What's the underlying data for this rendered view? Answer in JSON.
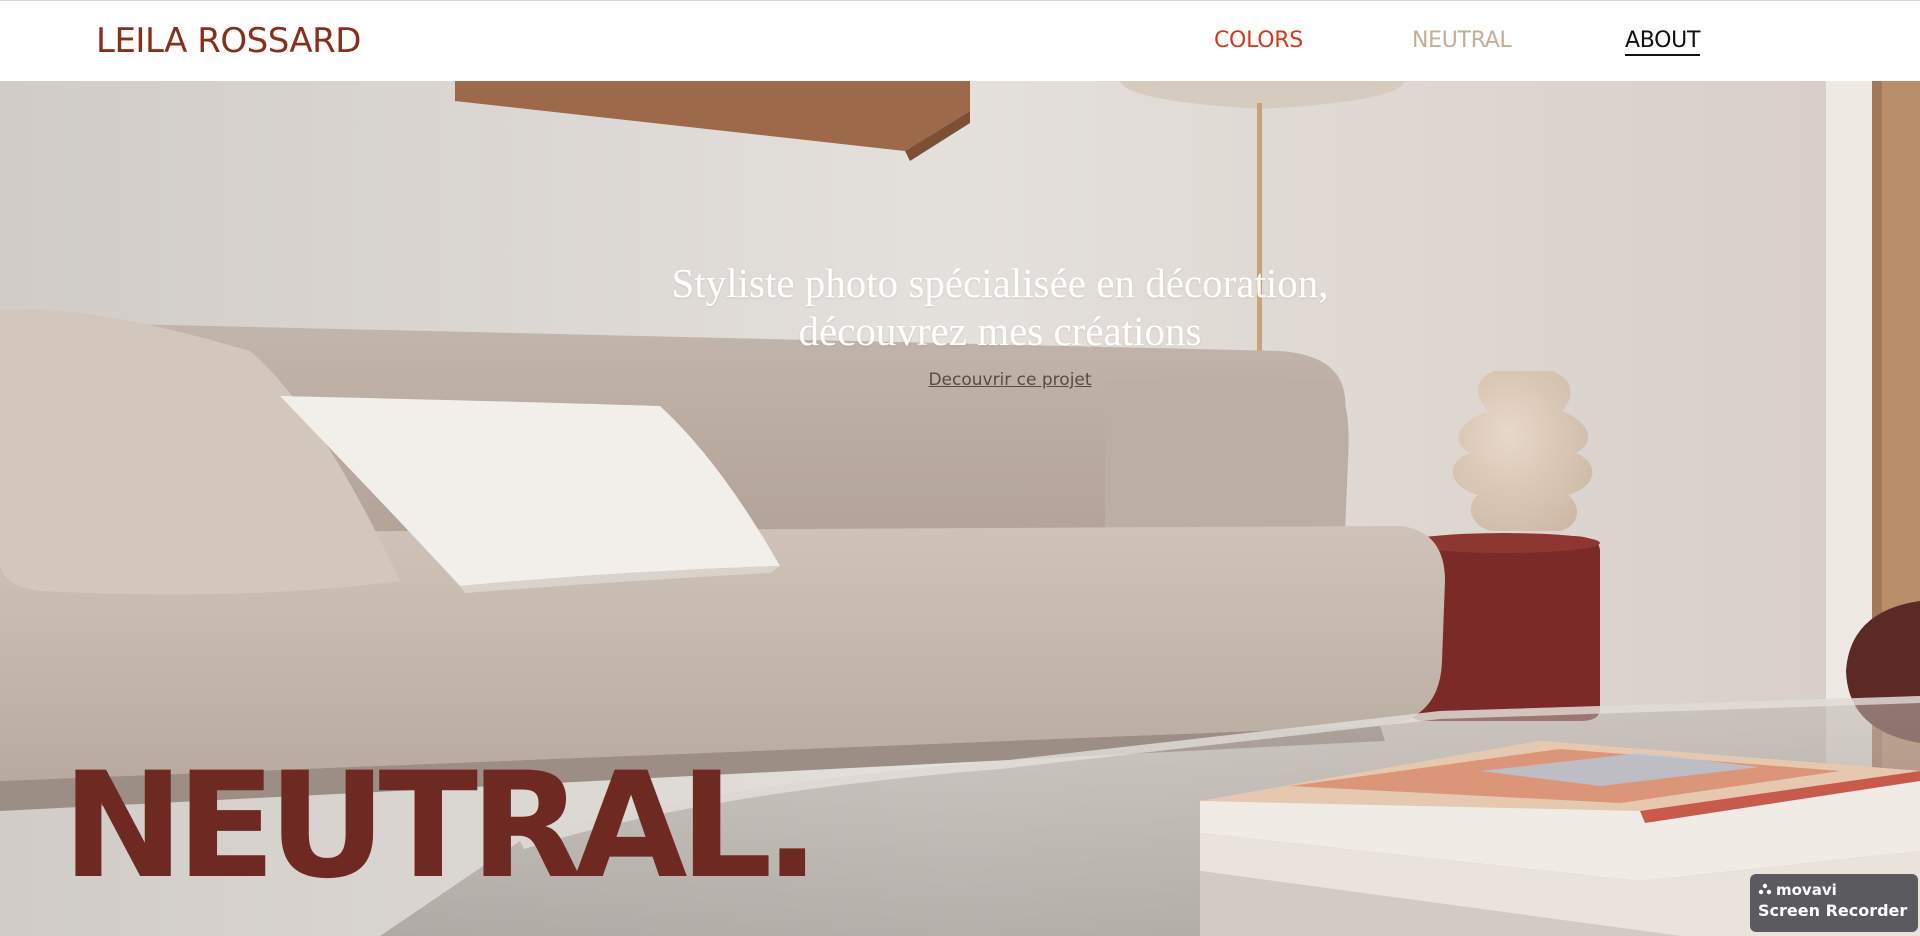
{
  "header": {
    "brand": "LEILA ROSSARD",
    "nav": {
      "colors": "COLORS",
      "neutral": "NEUTRAL",
      "about": "ABOUT"
    }
  },
  "hero": {
    "tagline_line1": "Styliste photo spécialisée en décoration,",
    "tagline_line2": "découvrez mes créations",
    "cta_label": "Decouvrir ce projet",
    "big_word": "NEUTRAL.",
    "image_subject": "living-room-sofa-photo"
  },
  "watermark": {
    "brand": "movavi",
    "product": "Screen Recorder"
  },
  "colors": {
    "brand": "#8a2e1a",
    "nav_colors": "#d23a1c",
    "nav_neutral": "#c5ad96",
    "nav_about": "#111111",
    "big_word": "#6e2a22"
  }
}
